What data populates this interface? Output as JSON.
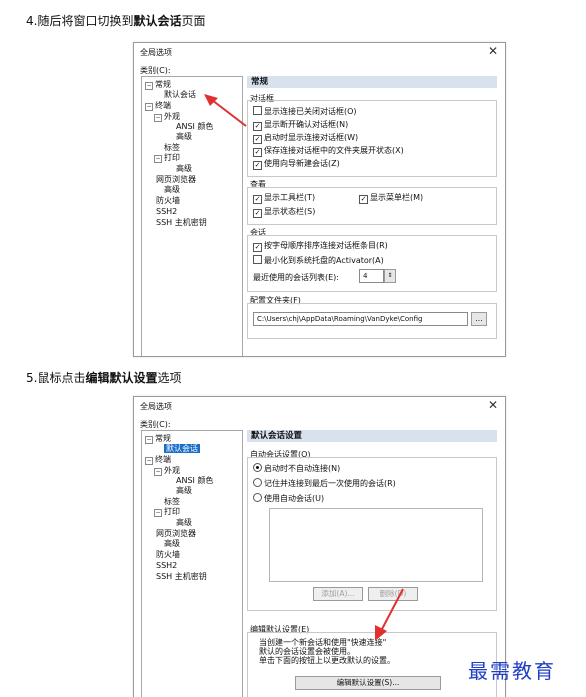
{
  "step4": {
    "prefix": "4.随后将窗口切换到",
    "bold": "默认会话",
    "suffix": "页面"
  },
  "step5": {
    "prefix": "5.鼠标点击",
    "bold": "编辑默认设置",
    "suffix": "选项"
  },
  "dialog": {
    "title": "全局选项",
    "close": "✕",
    "category_label": "类别(C):"
  },
  "tree": {
    "general": "常规",
    "default_session": "默认会话",
    "terminal": "终端",
    "appearance": "外观",
    "ansi_color": "ANSI 颜色",
    "advanced1": "高级",
    "tabs": "标签",
    "print": "打印",
    "advanced2": "高级",
    "web_browser": "网页浏览器",
    "advanced3": "高级",
    "firewall": "防火墙",
    "ssh2": "SSH2",
    "ssh_host_key": "SSH 主机密钥"
  },
  "panel1": {
    "header": "常规",
    "dialogs_group": "对话框",
    "dialogs": [
      {
        "label": "显示连接已关闭对话框(O)",
        "checked": false
      },
      {
        "label": "显示断开确认对话框(N)",
        "checked": true
      },
      {
        "label": "启动时显示连接对话框(W)",
        "checked": true
      },
      {
        "label": "保存连接对话框中的文件夹展开状态(X)",
        "checked": true
      },
      {
        "label": "使用向导新建会话(Z)",
        "checked": true
      }
    ],
    "view_group": "查看",
    "view": {
      "toolbar": "显示工具栏(T)",
      "menubar": "显示菜单栏(M)",
      "statusbar": "显示状态栏(S)"
    },
    "session_group": "会话",
    "session_sort": "按字母顺序排序连接对话框条目(R)",
    "minimize_tray": "最小化到系统托盘的Activator(A)",
    "recent_label": "最近使用的会话列表(E):",
    "recent_value": "4",
    "config_group": "配置文件夹(F)",
    "config_path": "C:\\Users\\chj\\AppData\\Roaming\\VanDyke\\Config",
    "browse": "..."
  },
  "panel2": {
    "header": "默认会话设置",
    "auto_group": "自动会话设置(O)",
    "options": [
      {
        "label": "启动时不自动连接(N)",
        "selected": true
      },
      {
        "label": "记住并连接到最后一次使用的会话(R)",
        "selected": false
      },
      {
        "label": "使用自动会话(U)",
        "selected": false
      }
    ],
    "add_btn": "添加(A)...",
    "delete_btn": "删除(D)",
    "edit_group": "编辑默认设置(E)",
    "edit_desc1": "当创建一个新会话和使用\"快速连接\"",
    "edit_desc2": "默认的会话设置会被使用。",
    "edit_desc3": "单击下面的按钮上以更改默认的设置。",
    "edit_btn": "编辑默认设置(S)..."
  },
  "watermark": "最需教育",
  "colors": {
    "selection": "#1a6fc7",
    "header_bg": "#d8e2ef",
    "arrow": "#e03131",
    "watermark": "#1f3fc4"
  }
}
